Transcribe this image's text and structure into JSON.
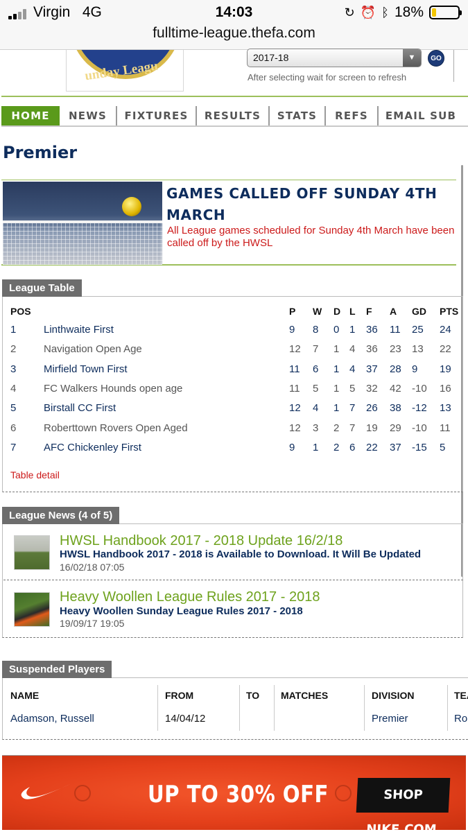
{
  "status_bar": {
    "carrier": "Virgin",
    "network": "4G",
    "time": "14:03",
    "battery": "18%",
    "battery_level": 0.18
  },
  "browser": {
    "url": "fulltime-league.thefa.com"
  },
  "header": {
    "logo_text": "unday Leagu",
    "season_value": "2017-18",
    "go_label": "GO",
    "refresh_note": "After selecting wait for screen to refresh"
  },
  "nav": [
    "HOME",
    "NEWS",
    "FIXTURES",
    "RESULTS",
    "STATS",
    "REFS",
    "EMAIL SUB"
  ],
  "page_title": "Premier",
  "banner": {
    "title": "GAMES CALLED OFF SUNDAY 4TH MARCH",
    "text": "All League games scheduled for Sunday 4th March have been called off by the HWSL"
  },
  "league_table": {
    "title": "League Table",
    "headers": [
      "POS",
      "P",
      "W",
      "D",
      "L",
      "F",
      "A",
      "GD",
      "PTS"
    ],
    "rows": [
      {
        "pos": "1",
        "team": "Linthwaite First",
        "p": "9",
        "w": "8",
        "d": "0",
        "l": "1",
        "f": "36",
        "a": "11",
        "gd": "25",
        "pts": "24"
      },
      {
        "pos": "2",
        "team": "Navigation Open Age",
        "p": "12",
        "w": "7",
        "d": "1",
        "l": "4",
        "f": "36",
        "a": "23",
        "gd": "13",
        "pts": "22"
      },
      {
        "pos": "3",
        "team": "Mirfield Town First",
        "p": "11",
        "w": "6",
        "d": "1",
        "l": "4",
        "f": "37",
        "a": "28",
        "gd": "9",
        "pts": "19"
      },
      {
        "pos": "4",
        "team": "FC Walkers Hounds open age",
        "p": "11",
        "w": "5",
        "d": "1",
        "l": "5",
        "f": "32",
        "a": "42",
        "gd": "-10",
        "pts": "16"
      },
      {
        "pos": "5",
        "team": "Birstall CC First",
        "p": "12",
        "w": "4",
        "d": "1",
        "l": "7",
        "f": "26",
        "a": "38",
        "gd": "-12",
        "pts": "13"
      },
      {
        "pos": "6",
        "team": "Roberttown Rovers Open Aged",
        "p": "12",
        "w": "3",
        "d": "2",
        "l": "7",
        "f": "19",
        "a": "29",
        "gd": "-10",
        "pts": "11"
      },
      {
        "pos": "7",
        "team": "AFC Chickenley First",
        "p": "9",
        "w": "1",
        "d": "2",
        "l": "6",
        "f": "22",
        "a": "37",
        "gd": "-15",
        "pts": "5"
      }
    ],
    "detail_link": "Table detail"
  },
  "league_news": {
    "title": "League News (4 of 5)",
    "items": [
      {
        "title": "HWSL Handbook 2017 - 2018 Update 16/2/18",
        "subtitle": "HWSL Handbook 2017 - 2018 is Available to Download. It Will Be Updated",
        "date": "16/02/18 07:05"
      },
      {
        "title": "Heavy Woollen League Rules 2017 - 2018",
        "subtitle": "Heavy Woollen Sunday League Rules 2017 - 2018",
        "date": "19/09/17 19:05"
      }
    ]
  },
  "suspended": {
    "title": "Suspended Players",
    "headers": [
      "NAME",
      "FROM",
      "TO",
      "MATCHES",
      "DIVISION",
      "TEA"
    ],
    "rows": [
      {
        "name": "Adamson, Russell",
        "from": "14/04/12",
        "to": "",
        "matches": "",
        "division": "Premier",
        "team": "Ro"
      }
    ]
  },
  "ad": {
    "headline": "UP TO 30% OFF",
    "cta": "SHOP NIKE.COM",
    "color": "#e4401b"
  }
}
